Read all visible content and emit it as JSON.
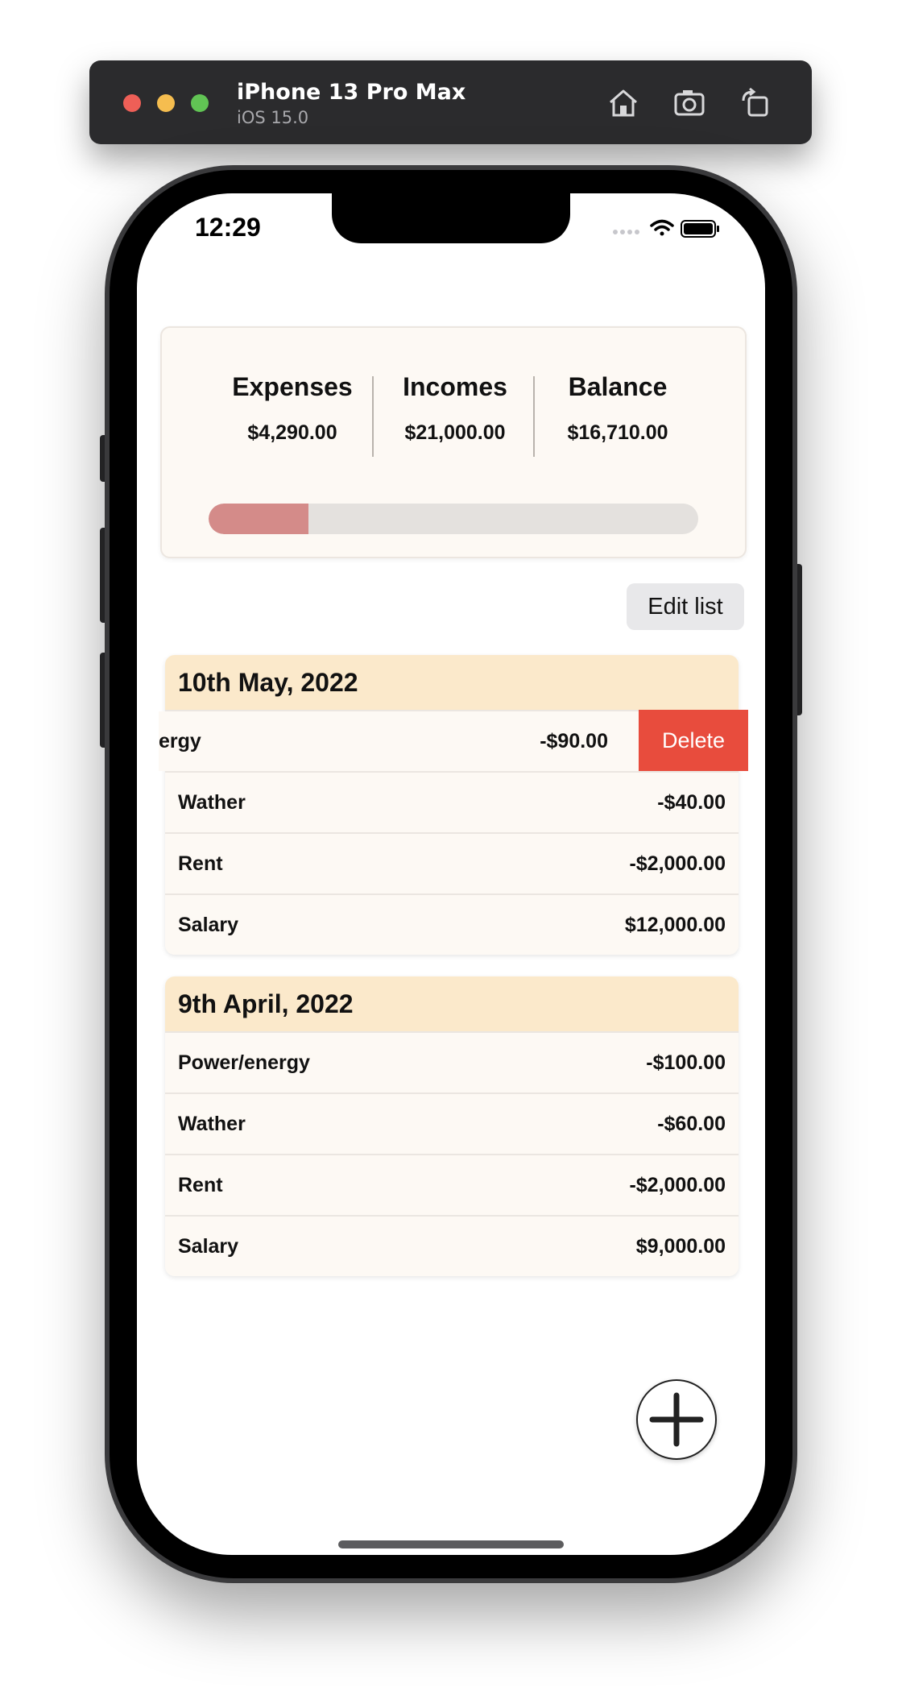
{
  "simulator": {
    "device_name": "iPhone 13 Pro Max",
    "os_version": "iOS 15.0",
    "icons": [
      "home-icon",
      "screenshot-icon",
      "rotate-icon"
    ]
  },
  "status_bar": {
    "time": "12:29",
    "icons": [
      "cellular-icon",
      "wifi-icon",
      "battery-icon"
    ]
  },
  "summary": {
    "expenses_label": "Expenses",
    "expenses_value": "$4,290.00",
    "incomes_label": "Incomes",
    "incomes_value": "$21,000.00",
    "balance_label": "Balance",
    "balance_value": "$16,710.00",
    "progress_fraction": 0.2043,
    "progress_color": "#d48b89"
  },
  "edit_list_label": "Edit list",
  "sections": [
    {
      "date": "10th May, 2022",
      "rows": [
        {
          "name": "ergy",
          "amount": "-$90.00"
        },
        {
          "name": "Wather",
          "amount": "-$40.00"
        },
        {
          "name": "Rent",
          "amount": "-$2,000.00"
        },
        {
          "name": "Salary",
          "amount": "$12,000.00"
        }
      ],
      "delete_label": "Delete"
    },
    {
      "date": "9th April, 2022",
      "rows": [
        {
          "name": "Power/energy",
          "amount": "-$100.00"
        },
        {
          "name": "Wather",
          "amount": "-$60.00"
        },
        {
          "name": "Rent",
          "amount": "-$2,000.00"
        },
        {
          "name": "Salary",
          "amount": "$9,000.00"
        }
      ]
    }
  ],
  "add_button_icon": "plus-icon",
  "colors": {
    "delete": "#e84c3d",
    "section_header": "#fbe9cb",
    "card_background": "#fdf9f4"
  }
}
